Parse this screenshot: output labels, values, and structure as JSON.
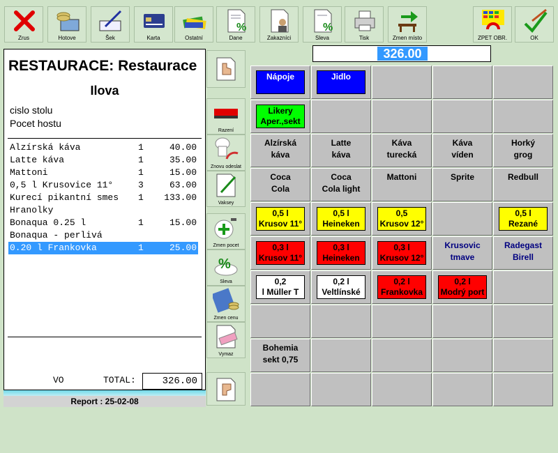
{
  "toolbar": {
    "zrus": "Zrus",
    "hotove": "Hotove",
    "sek": "Šek",
    "karta": "Karta",
    "ostatni": "Ostatní",
    "dane": "Dane",
    "zakaznici": "Zakazníci",
    "sleva": "Sleva",
    "tisk": "Tisk",
    "zmen_misto": "Zmen místo",
    "zpet_obr": "ZPET OBR.",
    "ok": "OK"
  },
  "receipt": {
    "title": "RESTAURACE: Restaurace",
    "waiter": "Ilova",
    "table_label": "cislo stolu",
    "guests_label": "Pocet hostu",
    "items": [
      {
        "name": "Alzírská káva",
        "qty": "1",
        "price": "40.00"
      },
      {
        "name": "Latte káva",
        "qty": "1",
        "price": "35.00"
      },
      {
        "name": "Mattoni",
        "qty": "1",
        "price": "15.00"
      },
      {
        "name": "0,5 l Krusovice 11°",
        "qty": "3",
        "price": "63.00"
      },
      {
        "name": "Kurecí pikantní smes",
        "qty": "1",
        "price": "133.00"
      },
      {
        "name": "Hranolky",
        "qty": "",
        "price": ""
      },
      {
        "name": "Bonaqua 0.25 l",
        "qty": "1",
        "price": "15.00"
      },
      {
        "name": "Bonaqua - perlivá",
        "qty": "",
        "price": ""
      },
      {
        "name": "0.20 l Frankovka",
        "qty": "1",
        "price": "25.00"
      }
    ],
    "vo": "VO",
    "total_label": "TOTAL:",
    "total": "326.00",
    "report": "Report : 25-02-08"
  },
  "side": {
    "razeni": "Razení",
    "znovu": "Znovu odeslat",
    "vaksey": "Vaksey",
    "zmen_pocet": "Zmen pocet",
    "sleva": "Sleva",
    "zmen_cenu": "Zmen cenu",
    "vymaz": "Vymaz"
  },
  "amount": "326.00",
  "grid": {
    "r0": [
      "Nápoje",
      "Jidlo"
    ],
    "r1": [
      "Likery\nAper.,sekt"
    ],
    "r2": [
      "Alzírská\nkáva",
      "Latte\nkáva",
      "Káva\nturecká",
      "Káva\nvíden",
      "Horký\ngrog"
    ],
    "r3": [
      "Coca\nCola",
      "Coca\nCola light",
      "Mattoni",
      "Sprite",
      "Redbull"
    ],
    "r4": [
      "0,5 l\nKrusov 11°",
      "0,5 l\nHeineken",
      "0,5\nKrusov 12°",
      "0,5 l\nRezané"
    ],
    "r5": [
      "0,3 l\nKrusov 11°",
      "0,3 l\nHeineken",
      "0,3 l\nKrusov 12°",
      "Krusovic\ntmave",
      "Radegast\nBirell"
    ],
    "r6": [
      "0,2\nl Müller T",
      "0,2 l\nVeltlínské",
      "0,2 l\nFrankovka",
      "0,2 l\nModrý port"
    ],
    "r8": [
      "Bohemia\nsekt  0,75"
    ]
  },
  "colors": {
    "background": "#cfe3c8",
    "blue": "#0000ff",
    "green": "#00ff00",
    "yellow": "#ffff00",
    "red": "#ff0000",
    "selection": "#3399ff"
  }
}
